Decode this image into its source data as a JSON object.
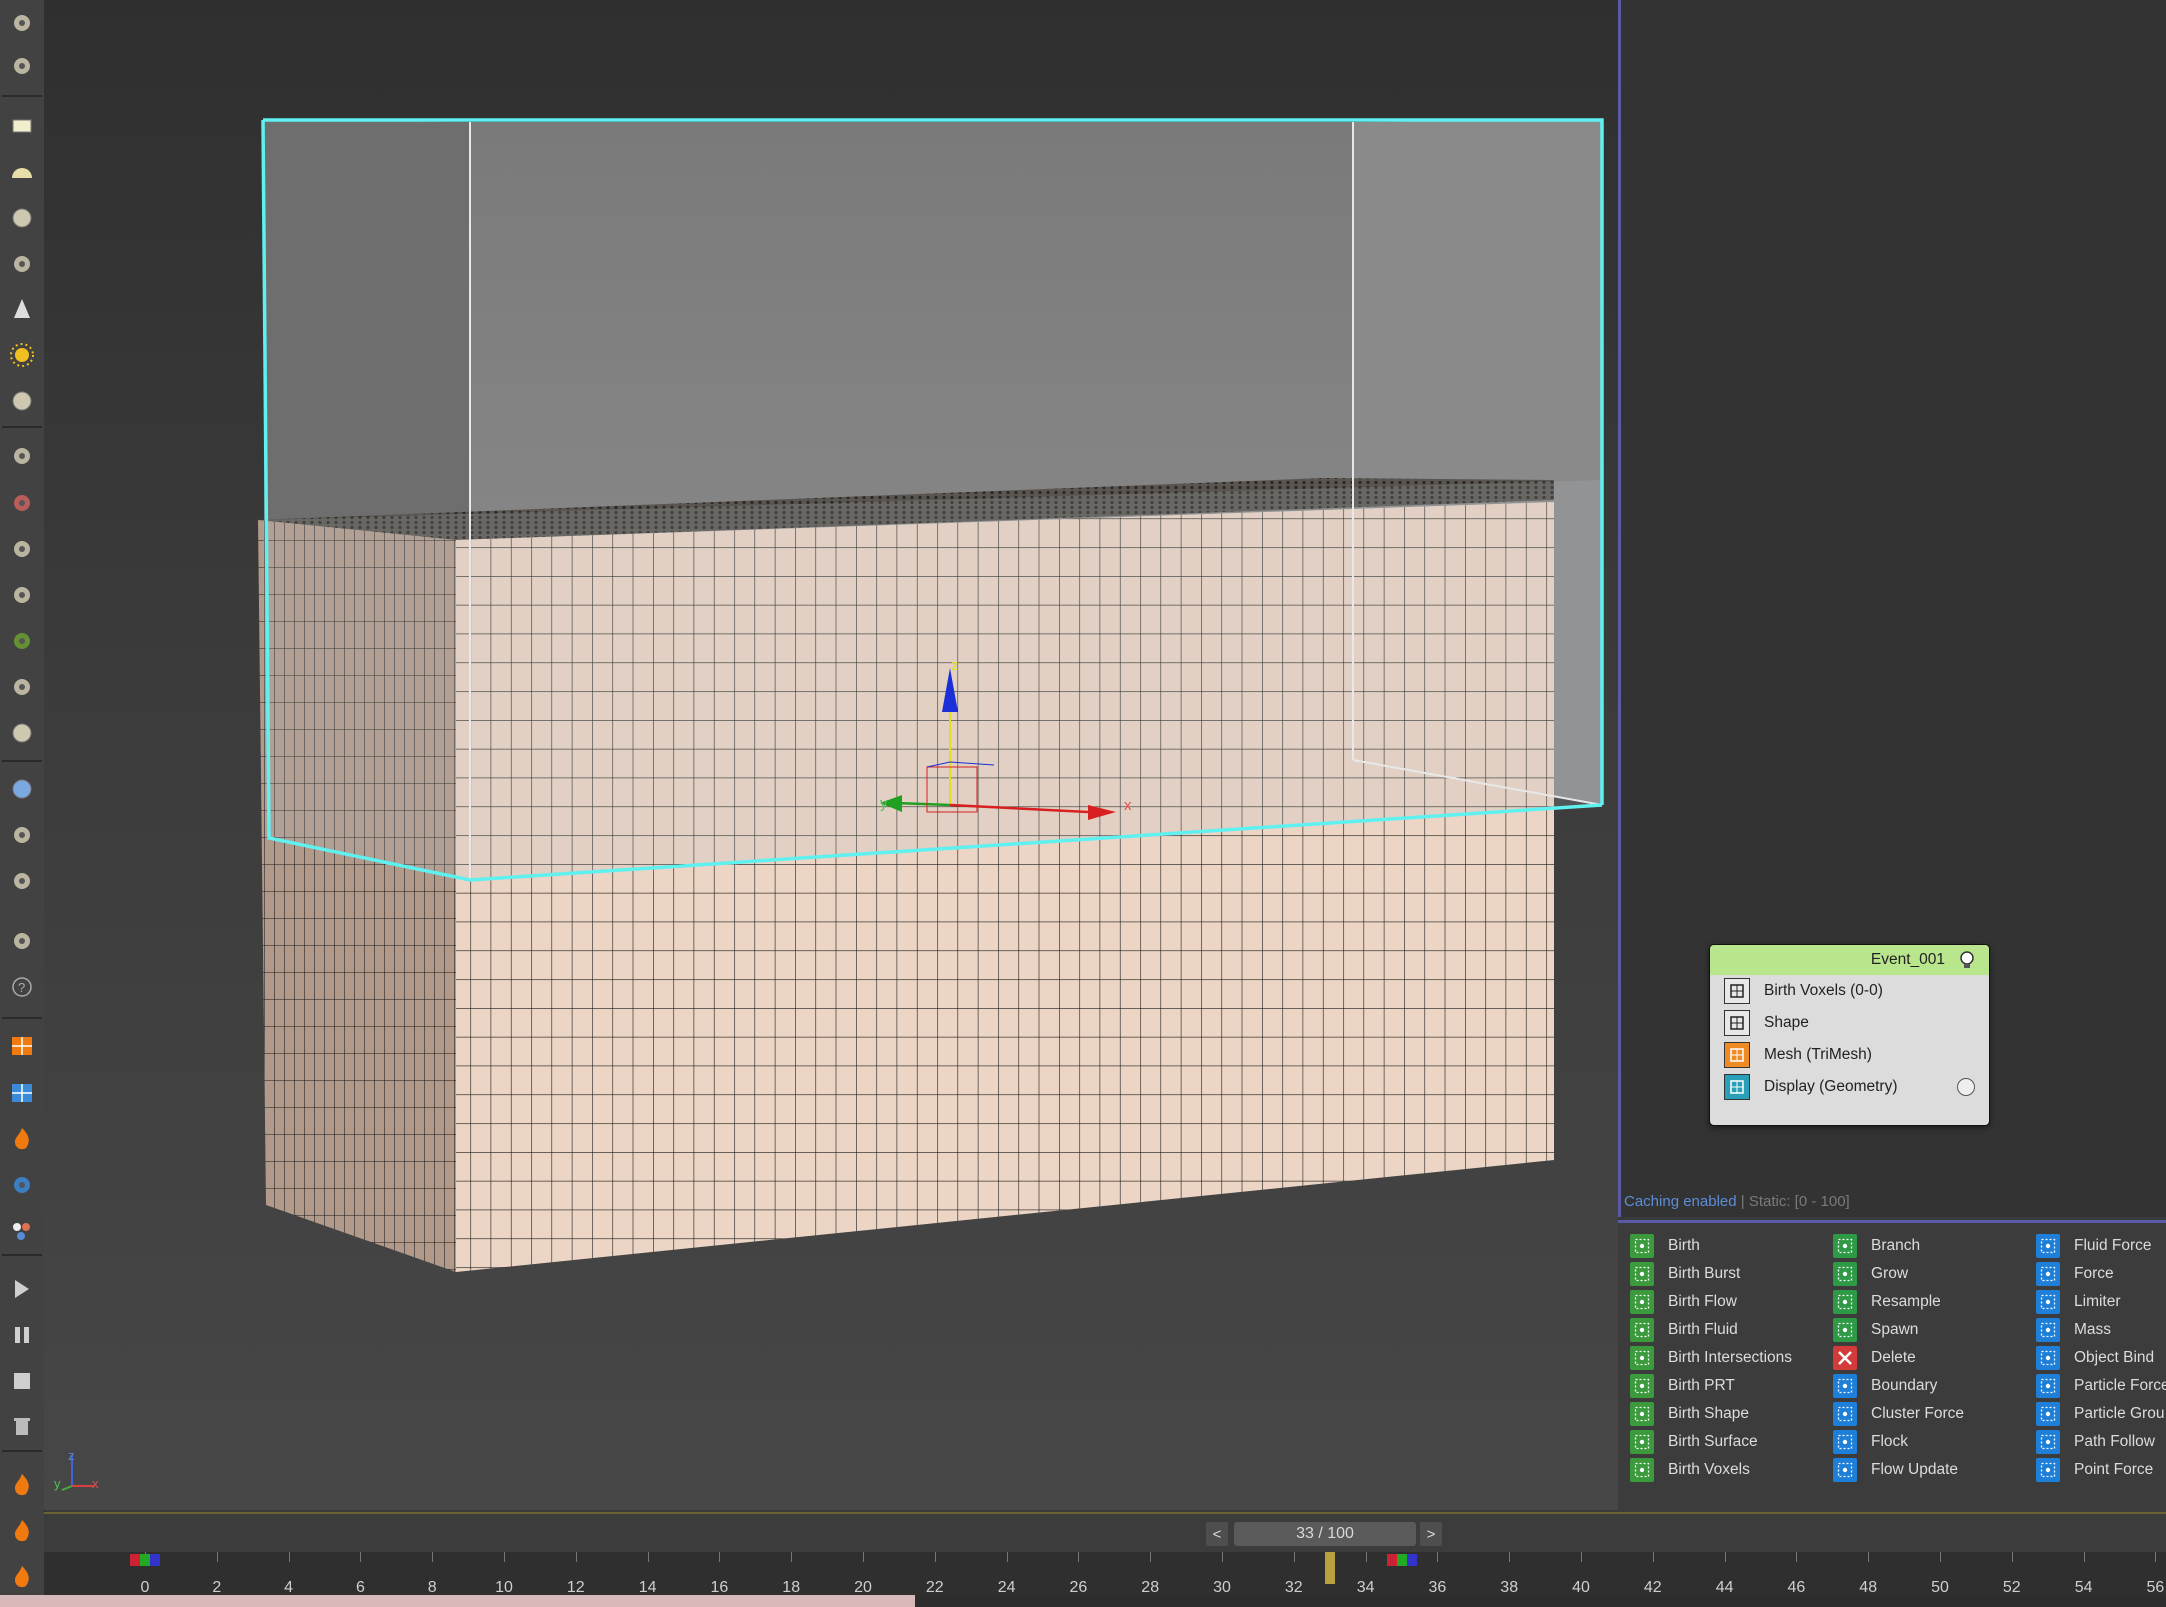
{
  "viewport": {
    "gizmo_labels": {
      "x": "x",
      "y": "y",
      "z": "z"
    },
    "axis_tripod": {
      "x": "x",
      "y": "y",
      "z": "z"
    }
  },
  "toolbar": {
    "icons": [
      "undo-icon",
      "film-icon",
      "plane-icon",
      "half-sphere-icon",
      "sphere-icon",
      "teapot-icon",
      "cone-icon",
      "sun-icon",
      "sphere-small-icon",
      "grid-particles-icon",
      "dna-icon",
      "spray-icon",
      "gear-globe-icon",
      "plant-icon",
      "horse-icon",
      "shell-icon",
      "globe-icon",
      "scatter-icon",
      "camera-globe-icon",
      "object-list-icon",
      "help-icon",
      "orange-tool-icon",
      "blue-grid-icon",
      "fire-icon",
      "water-icon",
      "bubbles-icon",
      "play-icon",
      "pause-icon",
      "stop-icon",
      "trash-icon",
      "flame-icon",
      "flame-alt-icon",
      "brush-icon"
    ]
  },
  "status": {
    "caching": "Caching enabled",
    "sep": " | ",
    "static": "Static: [0 - 100]"
  },
  "event": {
    "title": "Event_001",
    "operators": [
      {
        "label": "Birth Voxels (0-0)",
        "icon": "voxel-grid-icon",
        "color": "#222222"
      },
      {
        "label": "Shape",
        "icon": "cube-outline-icon",
        "color": "#222222"
      },
      {
        "label": "Mesh (TriMesh)",
        "icon": "mesh-icon",
        "color": "#f08a24"
      },
      {
        "label": "Display (Geometry)",
        "icon": "display-icon",
        "color": "#2aa0b8"
      }
    ]
  },
  "depot": {
    "columns": [
      [
        {
          "label": "Birth",
          "color": "#3b9a3b"
        },
        {
          "label": "Birth Burst",
          "color": "#3b9a3b"
        },
        {
          "label": "Birth Flow",
          "color": "#3b9a3b"
        },
        {
          "label": "Birth Fluid",
          "color": "#3b9a3b"
        },
        {
          "label": "Birth Intersections",
          "color": "#3b9a3b"
        },
        {
          "label": "Birth PRT",
          "color": "#3b9a3b"
        },
        {
          "label": "Birth Shape",
          "color": "#3b9a3b"
        },
        {
          "label": "Birth Surface",
          "color": "#3b9a3b"
        },
        {
          "label": "Birth Voxels",
          "color": "#3b9a3b"
        }
      ],
      [
        {
          "label": "Branch",
          "color": "#2f9a45"
        },
        {
          "label": "Grow",
          "color": "#2f9a45"
        },
        {
          "label": "Resample",
          "color": "#2f9a45"
        },
        {
          "label": "Spawn",
          "color": "#2f9a45"
        },
        {
          "label": "Delete",
          "color": "#d33a3a"
        },
        {
          "label": "Boundary",
          "color": "#1e7fd8"
        },
        {
          "label": "Cluster Force",
          "color": "#1e7fd8"
        },
        {
          "label": "Flock",
          "color": "#1e7fd8"
        },
        {
          "label": "Flow Update",
          "color": "#1e7fd8"
        }
      ],
      [
        {
          "label": "Fluid Force",
          "color": "#1e7fd8"
        },
        {
          "label": "Force",
          "color": "#1e7fd8"
        },
        {
          "label": "Limiter",
          "color": "#1e7fd8"
        },
        {
          "label": "Mass",
          "color": "#1e7fd8"
        },
        {
          "label": "Object Bind",
          "color": "#1e7fd8"
        },
        {
          "label": "Particle Force",
          "color": "#1e7fd8"
        },
        {
          "label": "Particle Grou",
          "color": "#1e7fd8"
        },
        {
          "label": "Path Follow",
          "color": "#1e7fd8"
        },
        {
          "label": "Point Force",
          "color": "#1e7fd8"
        }
      ]
    ]
  },
  "timeline": {
    "prev": "<",
    "next": ">",
    "frame_display": "33 / 100",
    "current_frame": 33,
    "total_frames": 100,
    "ticks": [
      "0",
      "2",
      "4",
      "6",
      "8",
      "10",
      "12",
      "14",
      "16",
      "18",
      "20",
      "22",
      "24",
      "26",
      "28",
      "30",
      "32",
      "34",
      "36",
      "38",
      "40",
      "42",
      "44",
      "46",
      "48",
      "50",
      "52",
      "54",
      "56"
    ],
    "playback_progress": 0.33
  }
}
